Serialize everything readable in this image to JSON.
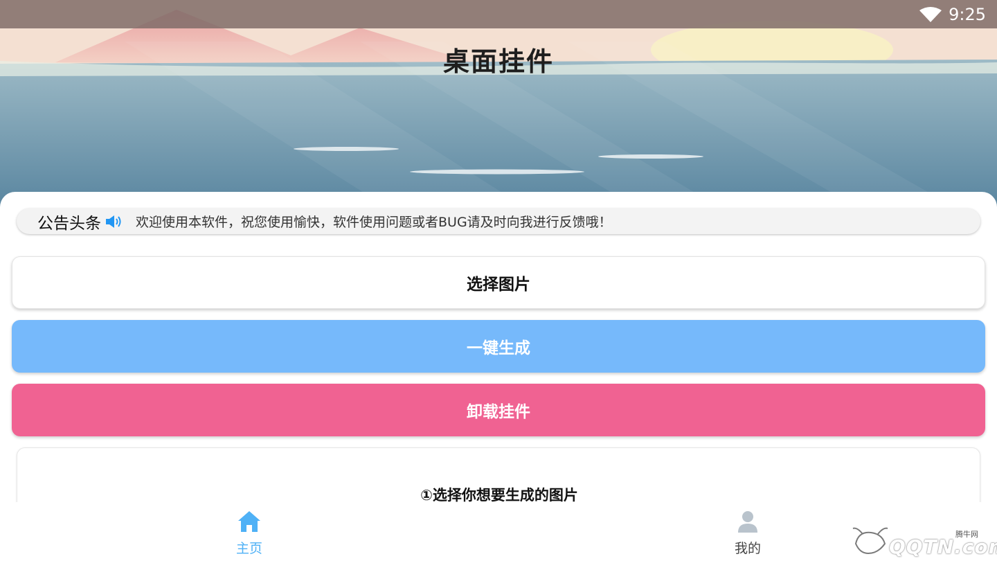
{
  "status_bar": {
    "time": "9:25"
  },
  "header": {
    "title": "桌面挂件"
  },
  "notice": {
    "label": "公告头条",
    "text": "欢迎使用本软件，祝您使用愉快，软件使用问题或者BUG请及时向我进行反馈哦！"
  },
  "actions": {
    "select_label": "选择图片",
    "generate_label": "一键生成",
    "uninstall_label": "卸载挂件"
  },
  "guide": {
    "step1": "①选择你想要生成的图片"
  },
  "nav": {
    "home_label": "主页",
    "me_label": "我的"
  },
  "watermark": {
    "brand": "QQTN.com",
    "tagline": "腾牛网"
  },
  "colors": {
    "generate_button": "#76b9fb",
    "uninstall_button": "#f06292",
    "nav_active": "#4fb1f6"
  }
}
